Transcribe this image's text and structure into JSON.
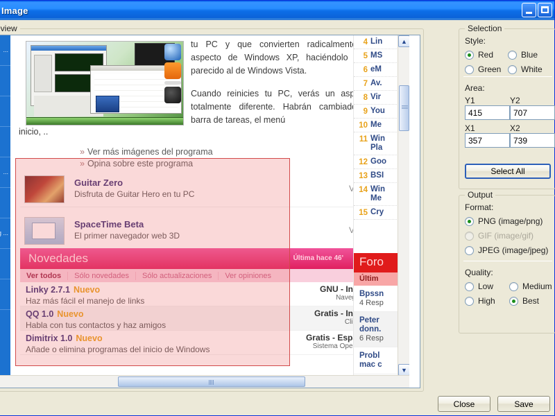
{
  "window": {
    "title": "Save Image"
  },
  "groups": {
    "preview": "Preview",
    "selection": "Selection",
    "output": "Output"
  },
  "selection_panel": {
    "style_label": "Style:",
    "styles": [
      {
        "label": "Red",
        "selected": true
      },
      {
        "label": "Blue",
        "selected": false
      },
      {
        "label": "Green",
        "selected": false
      },
      {
        "label": "White",
        "selected": false
      }
    ],
    "area_label": "Area:",
    "fields": [
      {
        "label": "Y1",
        "value": "415"
      },
      {
        "label": "Y2",
        "value": "707"
      },
      {
        "label": "X1",
        "value": "357"
      },
      {
        "label": "X2",
        "value": "739"
      }
    ],
    "select_all": "Select All"
  },
  "output_panel": {
    "format_label": "Format:",
    "formats": [
      {
        "label": "PNG (image/png)",
        "selected": true,
        "disabled": false
      },
      {
        "label": "GIF (image/gif)",
        "selected": false,
        "disabled": true
      },
      {
        "label": "JPEG (image/jpeg)",
        "selected": false,
        "disabled": false
      }
    ],
    "quality_label": "Quality:",
    "qualities": [
      {
        "label": "Low",
        "selected": false
      },
      {
        "label": "Medium",
        "selected": false
      },
      {
        "label": "High",
        "selected": false
      },
      {
        "label": "Best",
        "selected": true
      }
    ]
  },
  "buttons": {
    "close": "Close",
    "save": "Save"
  },
  "webpage": {
    "leftnav": [
      "...",
      "",
      "",
      "",
      "...",
      "",
      "g ...",
      "",
      ""
    ],
    "article": {
      "paragraphs": [
        "tu PC y que convierten radicalmente el aspecto de Windows XP, haciéndolo muy parecido al de Windows Vista.",
        "Cuando reinicies tu PC, verás un aspecto totalmente diferente. Habrán cambiado la barra de tareas, el menú"
      ],
      "tail": "inicio, .."
    },
    "links": [
      "Ver más imágenes del programa",
      "Opina sobre este programa"
    ],
    "programs": [
      {
        "title": "Guitar Zero",
        "desc": "Disfruta de Guitar Hero en tu PC",
        "action": "Ver »"
      },
      {
        "title": "SpaceTime Beta",
        "desc": "El primer navegador web 3D",
        "action": "Ver »"
      }
    ],
    "novedades": {
      "title": "Novedades",
      "last": "Última hace 46'",
      "tabs": [
        {
          "label": "Ver todos",
          "active": true
        },
        {
          "label": "Sólo novedades",
          "active": false
        },
        {
          "label": "Sólo actualizaciones",
          "active": false
        },
        {
          "label": "Ver opiniones",
          "active": false
        }
      ],
      "rows": [
        {
          "name": "Linky 2.7.1",
          "badge": "Nuevo",
          "desc": "Haz más fácil el manejo de links",
          "right": "GNU - Ingles",
          "cat": "Navegador"
        },
        {
          "name": "QQ 1.0",
          "badge": "Nuevo",
          "desc": "Habla con tus contactos y haz amigos",
          "right": "Gratis - Ingles",
          "cat": "Clientes"
        },
        {
          "name": "Dimitrix 1.0",
          "badge": "Nuevo",
          "desc": "Añade o elimina programas del inicio de Windows",
          "right": "Gratis - Español",
          "cat": "Sistema Operativo"
        }
      ]
    },
    "ranking": [
      {
        "n": "4",
        "t": "Lin"
      },
      {
        "n": "5",
        "t": "MS"
      },
      {
        "n": "6",
        "t": "eM"
      },
      {
        "n": "7",
        "t": "Av."
      },
      {
        "n": "8",
        "t": "Vir"
      },
      {
        "n": "9",
        "t": "You"
      },
      {
        "n": "10",
        "t": "Me"
      },
      {
        "n": "11",
        "t": "Win\nPla"
      },
      {
        "n": "12",
        "t": "Goo"
      },
      {
        "n": "13",
        "t": "BSI"
      },
      {
        "n": "14",
        "t": "Win\nMe"
      },
      {
        "n": "15",
        "t": "Cry"
      }
    ],
    "foro": {
      "title": "Foro",
      "subtitle": "Últim",
      "posts": [
        {
          "t": "Bpssn",
          "n": "4 Resp"
        },
        {
          "t": "Peter\ndonn.",
          "n": "6 Resp"
        },
        {
          "t": "Probl\nmac c",
          "n": ""
        }
      ]
    }
  },
  "icons": {
    "minimize": "minimize-icon",
    "maximize": "maximize-icon",
    "star": "★",
    "scroll_up": "▲",
    "scroll_down": "▼",
    "scroll_right": "❯",
    "chevron": "»"
  }
}
